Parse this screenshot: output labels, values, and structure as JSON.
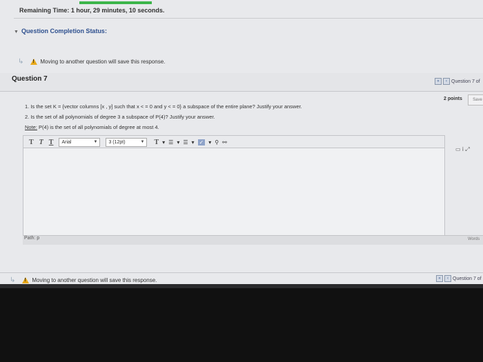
{
  "timer": {
    "text": "Remaining Time: 1 hour, 29 minutes, 10 seconds."
  },
  "status": {
    "label": "Question Completion Status:"
  },
  "warning_top": {
    "text": "Moving to another question will save this response."
  },
  "question": {
    "title": "Question 7",
    "nav_label": "Question 7 of",
    "points": "2 points",
    "save_label": "Save",
    "lines": [
      "1. Is the set K = {vector columns [x , y] such that x < = 0 and y < = 0} a subspace of the entire plane? Justify your answer.",
      "2. Is the set of all polynomials of degree 3 a subspace of P(4)? Justify your answer."
    ],
    "note_label": "Note:",
    "note_text": " P(4) is the set of all polynomials of degree at most 4."
  },
  "toolbar": {
    "font_family": "Arial",
    "font_size": "3 (12pt)"
  },
  "editor": {
    "path_label": "Path: p",
    "words_label": "Words"
  },
  "warning_bottom": {
    "text": "Moving to another question will save this response."
  },
  "nav_bottom": {
    "label": "Question 7 of"
  },
  "colors": {
    "accent": "#3cb54a",
    "link": "#2d4f8e",
    "warning": "#e8a818"
  }
}
